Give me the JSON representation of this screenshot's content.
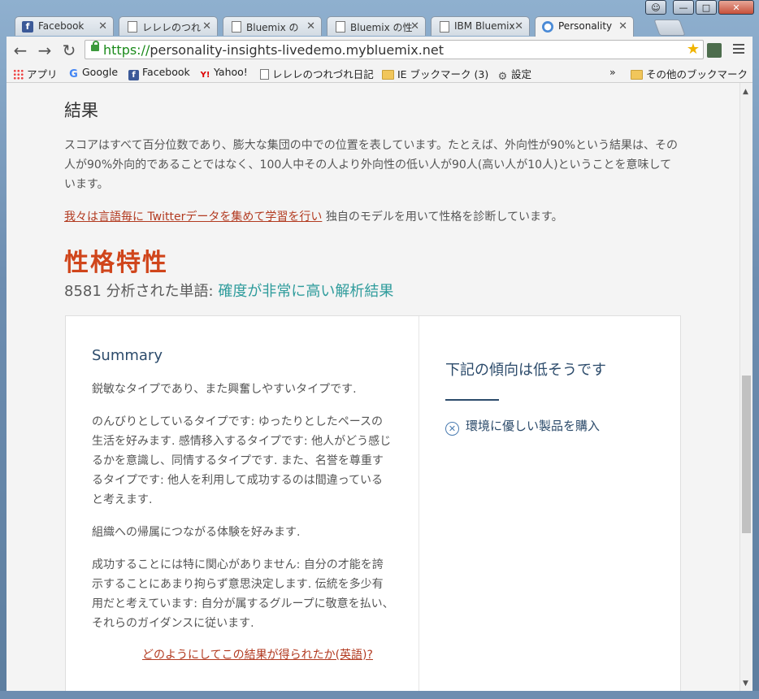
{
  "browser": {
    "tabs": [
      {
        "label": "Facebook",
        "icon": "facebook-icon"
      },
      {
        "label": "レレレのつれ",
        "icon": "document-icon"
      },
      {
        "label": "Bluemix の",
        "icon": "document-icon"
      },
      {
        "label": "Bluemix の性",
        "icon": "document-icon"
      },
      {
        "label": "IBM Bluemix",
        "icon": "document-icon"
      },
      {
        "label": "Personality",
        "icon": "globe-icon"
      }
    ],
    "url_scheme": "https://",
    "url_rest": "personality-insights-livedemo.mybluemix.net",
    "bookmarks": [
      {
        "label": "アプリ",
        "icon": "apps-icon"
      },
      {
        "label": "Google",
        "icon": "google-icon"
      },
      {
        "label": "Facebook",
        "icon": "facebook-icon"
      },
      {
        "label": "Yahoo!",
        "icon": "yahoo-icon"
      },
      {
        "label": "レレレのつれづれ日記",
        "icon": "document-icon"
      },
      {
        "label": "IE ブックマーク (3)",
        "icon": "folder-icon"
      },
      {
        "label": "設定",
        "icon": "gear-icon"
      }
    ],
    "bookmarks_more": "»",
    "other_bookmarks": "その他のブックマーク"
  },
  "page": {
    "result_heading": "結果",
    "description": "スコアはすべて百分位数であり、膨大な集団の中での位置を表しています。たとえば、外向性が90%という結果は、その人が90%外向的であることではなく、100人中その人より外向性の低い人が90人(高い人が10人)ということを意味しています。",
    "link_text": "我々は言語毎に Twitterデータを集めて学習を行い",
    "link_suffix": " 独自のモデルを用いて性格を診断しています。",
    "trait_heading": "性格特性",
    "word_count_prefix": "8581 分析された単語: ",
    "confidence": "確度が非常に高い解析結果",
    "summary_title": "Summary",
    "summary_paragraphs": [
      "鋭敏なタイプであり、また興奮しやすいタイプです.",
      "のんびりとしているタイプです: ゆったりとしたペースの生活を好みます. 感情移入するタイプです: 他人がどう感じるかを意識し、同情するタイプです. また、名誉を尊重するタイプです: 他人を利用して成功するのは間違っていると考えます.",
      "組織への帰属につながる体験を好みます.",
      "成功することには特に関心がありません: 自分の才能を誇示することにあまり拘らず意思決定します. 伝統を多少有用だと考えています: 自分が属するグループに敬意を払い、それらのガイダンスに従います."
    ],
    "how_link": "どのようにしてこの結果が得られたか(英語)?",
    "unlikely_title": "下記の傾向は低そうです",
    "unlikely_items": [
      "環境に優しい製品を購入"
    ]
  },
  "colors": {
    "accent": "#d0451b",
    "link": "#b23a20",
    "confidence": "#2f9c9c",
    "heading_blue": "#2c4b6b"
  }
}
